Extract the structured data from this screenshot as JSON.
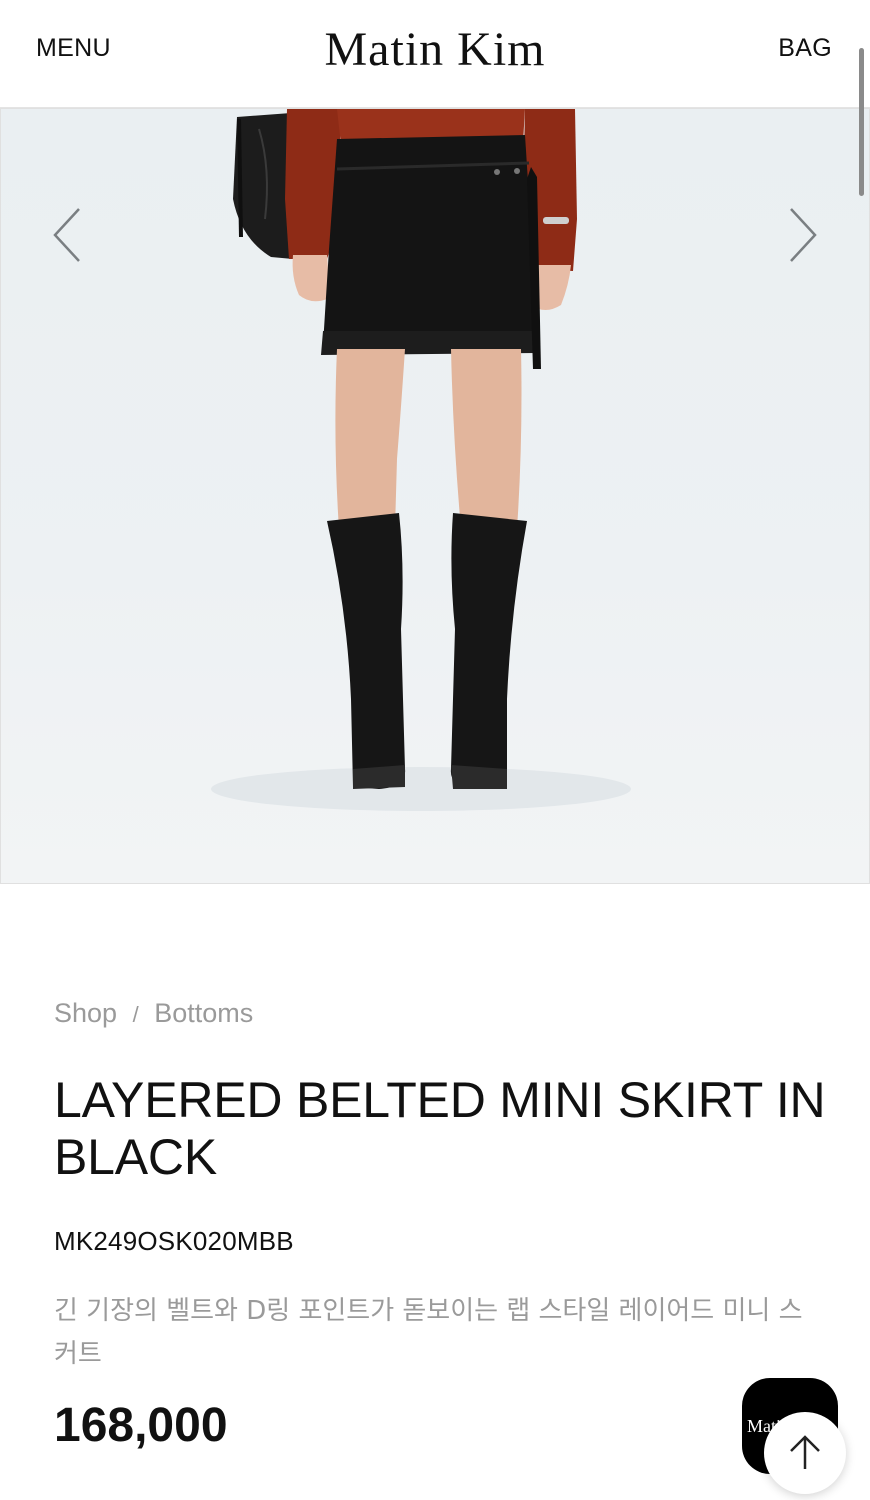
{
  "header": {
    "menu_label": "MENU",
    "logo_text": "Matin Kim",
    "bag_label": "BAG"
  },
  "gallery": {
    "prev_icon": "chevron-left-icon",
    "next_icon": "chevron-right-icon"
  },
  "product": {
    "breadcrumb": [
      "Shop",
      "Bottoms"
    ],
    "breadcrumb_separator": "/",
    "name": "LAYERED BELTED MINI SKIRT IN BLACK",
    "sku": "MK249OSK020MBB",
    "description": "긴 기장의 벨트와 D링 포인트가 돋보이는 랩 스타일 레이어드 미니 스커트",
    "price": "168,000"
  },
  "floating": {
    "chat_label": "Matin Kim",
    "top_icon": "arrow-up-icon"
  },
  "colors": {
    "text": "#111111",
    "muted": "#9a9a9a",
    "background": "#ffffff",
    "photo_background": "#edf1f3"
  }
}
